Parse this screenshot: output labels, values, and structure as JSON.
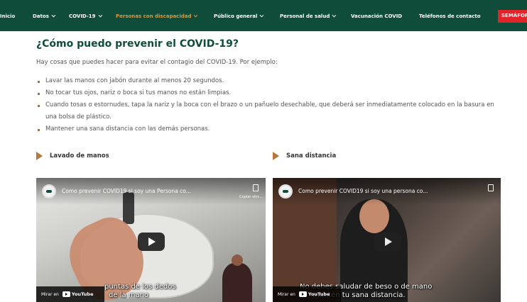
{
  "nav": {
    "items": [
      {
        "label": "Inicio",
        "dropdown": false,
        "active": false
      },
      {
        "label": "Datos",
        "dropdown": true,
        "active": false
      },
      {
        "label": "COVID-19",
        "dropdown": true,
        "active": false
      },
      {
        "label": "Personas con discapacidad",
        "dropdown": true,
        "active": true
      },
      {
        "label": "Público general",
        "dropdown": true,
        "active": false
      },
      {
        "label": "Personal de salud",
        "dropdown": true,
        "active": false
      },
      {
        "label": "Vacunación COVID",
        "dropdown": false,
        "active": false
      },
      {
        "label": "Teléfonos de contacto",
        "dropdown": false,
        "active": false
      }
    ],
    "badge": "SEMÁFORO"
  },
  "content": {
    "title": "¿Cómo puedo prevenir el COVID-19?",
    "intro": "Hay cosas que puedes hacer para evitar el contagio del COVID-19. Por ejemplo:",
    "tips": [
      "Lavar las manos con jabón durante al menos 20 segundos.",
      "No tocar tus ojos, nariz o boca si tus manos no están limpias.",
      "Cuando tosas o estornudes, tapa la nariz y la boca con el brazo o un pañuelo desechable, que deberá ser inmediatamente colocado en la basura en una bolsa de plástico.",
      "Mantener una sana distancia con las demás personas."
    ]
  },
  "sections": [
    {
      "heading": "Lavado de manos",
      "video": {
        "title": "Como prevenir COVID19 si soy una Persona co...",
        "copy_label": "Copiar vínc...",
        "caption_line1": "puntas de los dedos",
        "caption_line2": "de la mano",
        "watch_on": "Mirar en",
        "youtube": "YouTube"
      }
    },
    {
      "heading": "Sana distancia",
      "video": {
        "title": "Como prevenir COVID19 si soy una persona co...",
        "caption_line1": "No debes saludar de beso o de mano",
        "caption_line2": "mantén tu sana distancia.",
        "watch_on": "Mirar en",
        "youtube": "YouTube"
      }
    }
  ],
  "colors": {
    "nav_bg": "#0f4c3a",
    "nav_active": "#d39a45",
    "badge_bg": "#e0242a",
    "title": "#0f4c3a",
    "accent": "#b5783c"
  }
}
